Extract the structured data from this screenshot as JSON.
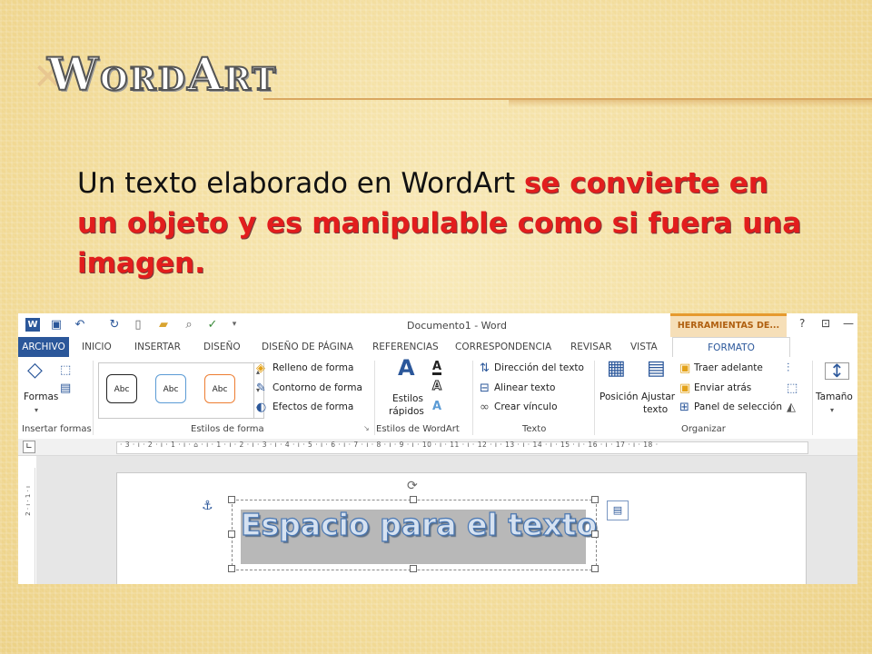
{
  "slide": {
    "title": "WordArt",
    "body_plain": "Un texto elaborado en WordArt ",
    "body_red": "se convierte en un objeto y es manipulable como si fuera una imagen."
  },
  "word": {
    "doc_title": "Documento1 - Word",
    "tools_tab": "HERRAMIENTAS DE...",
    "window_controls": [
      "?",
      "⊡",
      "—"
    ],
    "tabs": [
      "ARCHIVO",
      "INICIO",
      "INSERTAR",
      "DISEÑO",
      "DISEÑO DE PÁGINA",
      "REFERENCIAS",
      "CORRESPONDENCIA",
      "REVISAR",
      "VISTA",
      "FORMATO"
    ],
    "ribbon": {
      "formas": "Formas",
      "insertar_formas": "Insertar formas",
      "abc": "Abc",
      "relleno": "Relleno de forma",
      "contorno": "Contorno de forma",
      "efectos": "Efectos de forma",
      "estilos_forma": "Estilos de forma",
      "estilos_rapidos_1": "Estilos",
      "estilos_rapidos_2": "rápidos",
      "estilos_wordart": "Estilos de WordArt",
      "direccion": "Dirección del texto",
      "alinear": "Alinear texto",
      "crear_vinculo": "Crear vínculo",
      "texto": "Texto",
      "posicion": "Posición",
      "ajustar_1": "Ajustar",
      "ajustar_2": "texto",
      "traer": "Traer adelante",
      "enviar": "Enviar atrás",
      "panel": "Panel de selección",
      "organizar": "Organizar",
      "tamano": "Tamaño"
    },
    "ruler_numbers": "· 3 · ı · 2 · ı · 1 · ı · ⌂ · ı · 1 · ı · 2 · ı · 3 · ı · 4 · ı · 5 · ı · 6 · ı · 7 · ı · 8 · ı · 9 · ı · 10 · ı · 11 · ı · 12 · ı · 13 · ı · 14 · ı · 15 · ı · 16 · ı · 17 · ı · 18 ·",
    "vruler_numbers": "2 · ı · 1 · ı",
    "wordart_text": "Espacio para el texto"
  }
}
